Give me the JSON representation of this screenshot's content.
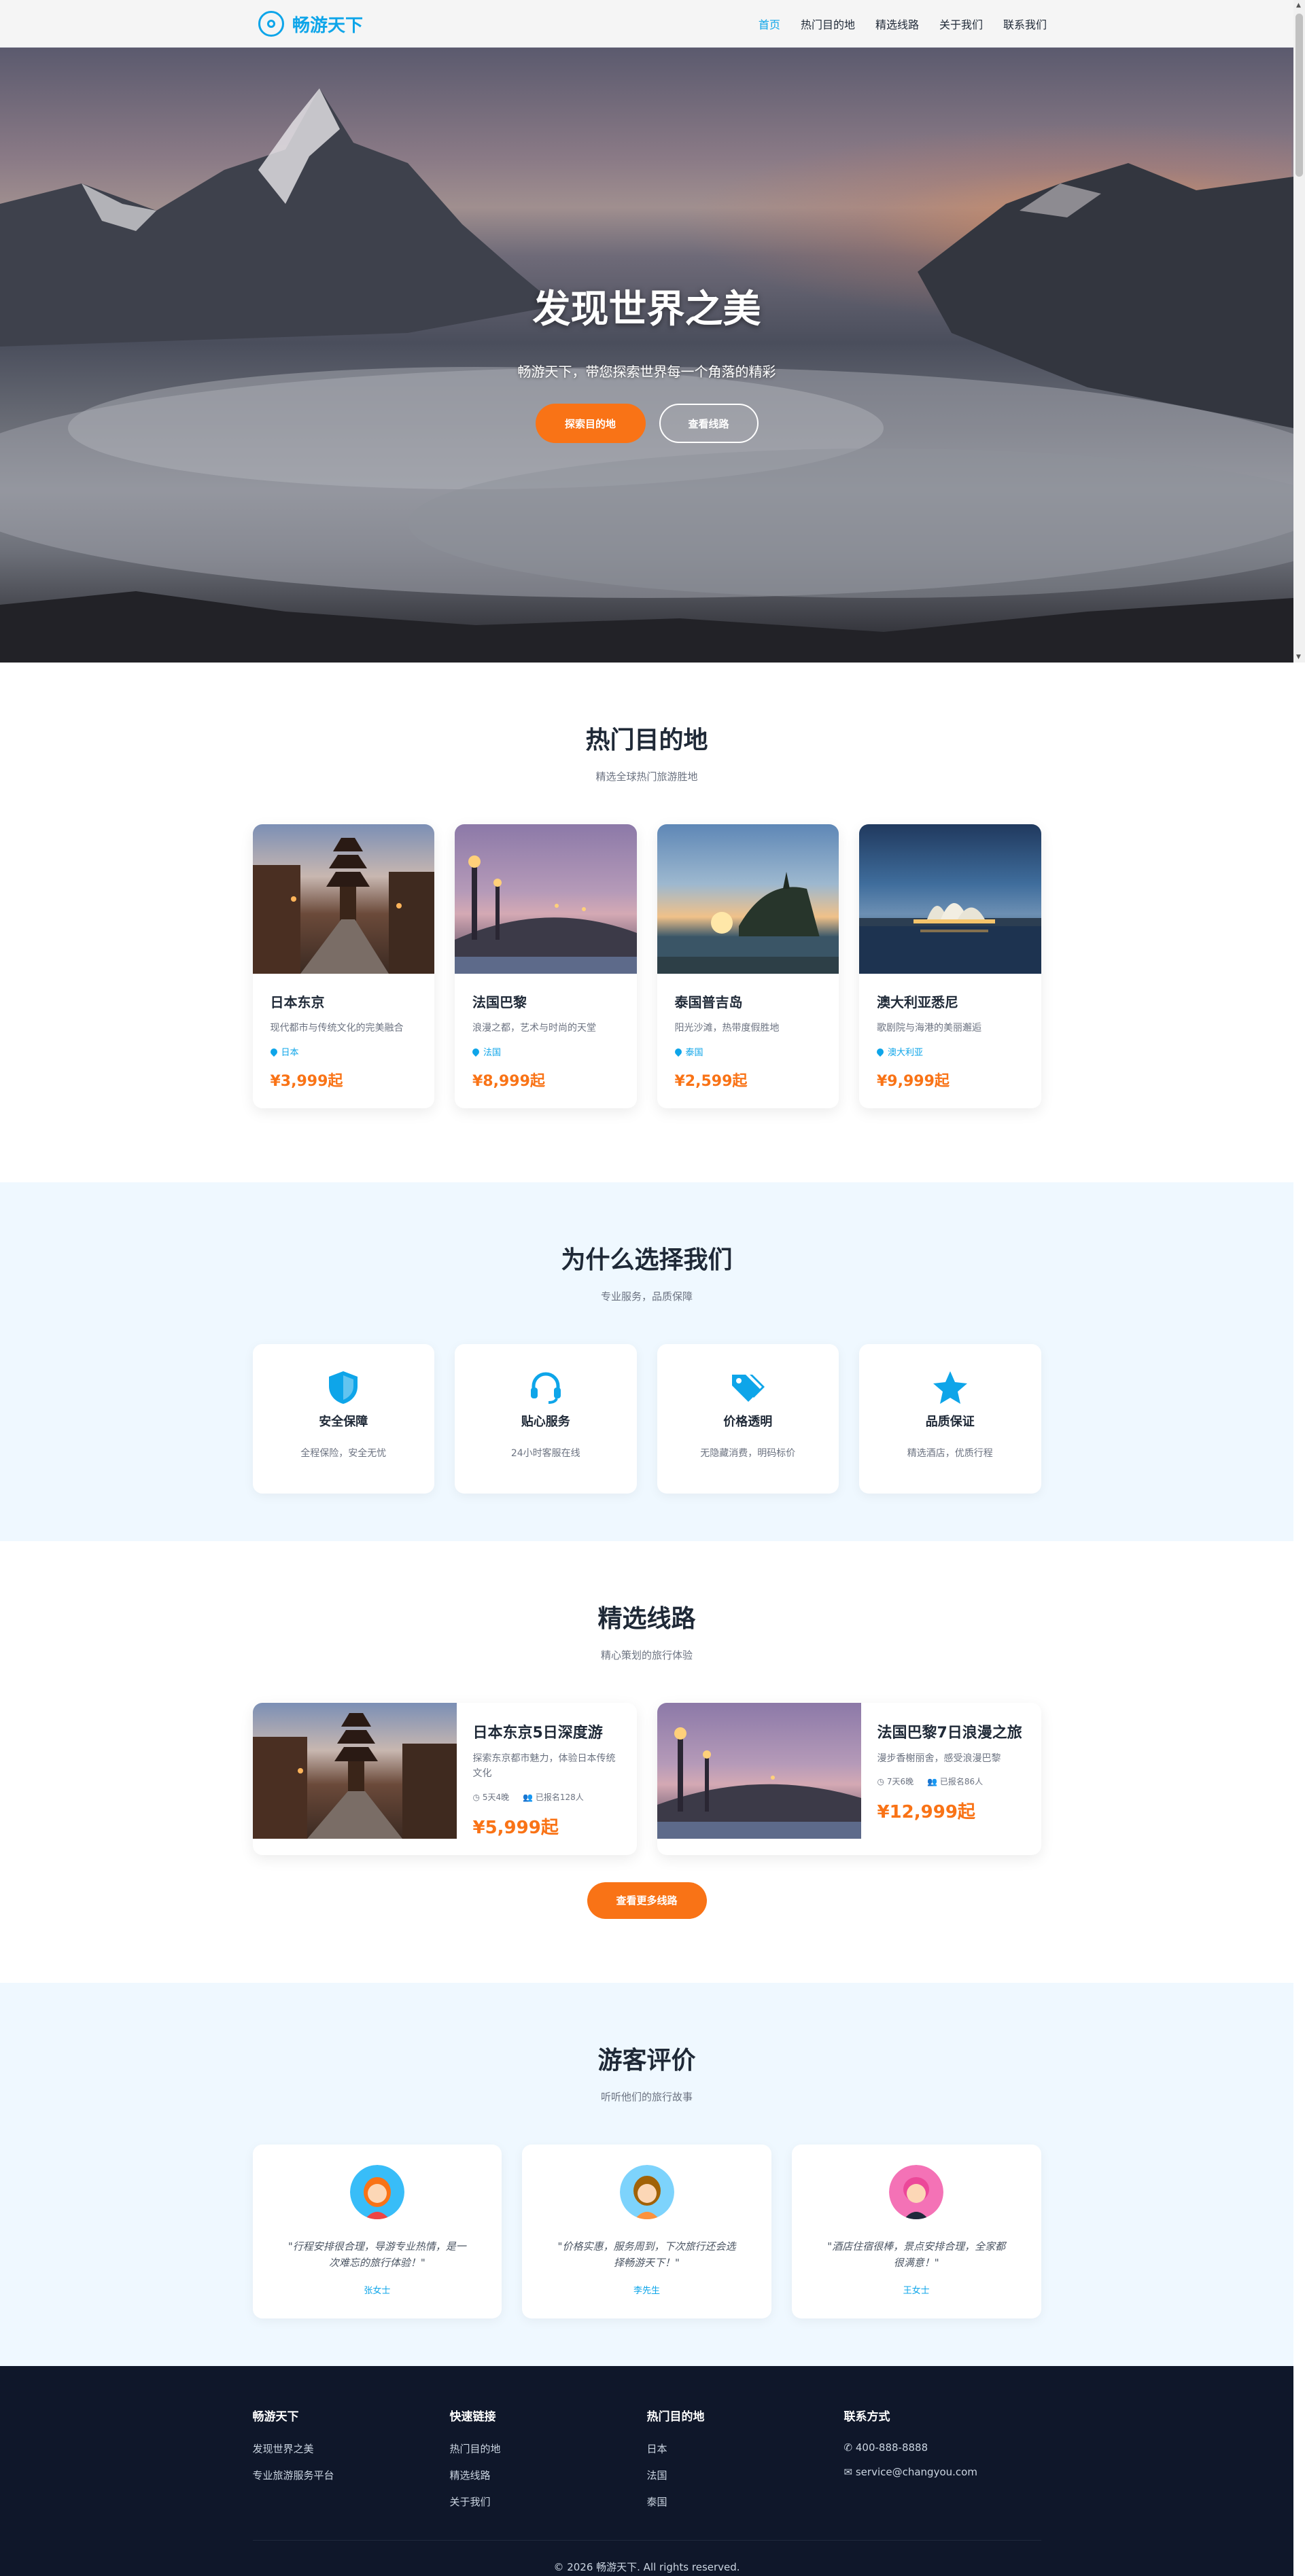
{
  "brand": {
    "name": "畅游天下"
  },
  "nav": {
    "items": [
      {
        "label": "首页",
        "active": true
      },
      {
        "label": "热门目的地"
      },
      {
        "label": "精选线路"
      },
      {
        "label": "关于我们"
      },
      {
        "label": "联系我们"
      }
    ]
  },
  "hero": {
    "title": "发现世界之美",
    "subtitle": "畅游天下，带您探索世界每一个角落的精彩",
    "primary_button": "探索目的地",
    "secondary_button": "查看线路"
  },
  "destinations": {
    "title": "热门目的地",
    "subtitle": "精选全球热门旅游胜地",
    "items": [
      {
        "name": "日本东京",
        "desc": "现代都市与传统文化的完美融合",
        "location": "日本",
        "price": "¥3,999起",
        "scene": "pagoda-street"
      },
      {
        "name": "法国巴黎",
        "desc": "浪漫之都，艺术与时尚的天堂",
        "location": "法国",
        "price": "¥8,999起",
        "scene": "bridge-lamps"
      },
      {
        "name": "泰国普吉岛",
        "desc": "阳光沙滩，热带度假胜地",
        "location": "泰国",
        "price": "¥2,599起",
        "scene": "temple-sunset"
      },
      {
        "name": "澳大利亚悉尼",
        "desc": "歌剧院与海港的美丽邂逅",
        "location": "澳大利亚",
        "price": "¥9,999起",
        "scene": "opera-house"
      }
    ]
  },
  "why": {
    "title": "为什么选择我们",
    "subtitle": "专业服务，品质保障",
    "items": [
      {
        "name": "安全保障",
        "desc": "全程保险，安全无忧",
        "icon": "shield-icon"
      },
      {
        "name": "贴心服务",
        "desc": "24小时客服在线",
        "icon": "headset-icon"
      },
      {
        "name": "价格透明",
        "desc": "无隐藏消费，明码标价",
        "icon": "tag-icon"
      },
      {
        "name": "品质保证",
        "desc": "精选酒店，优质行程",
        "icon": "star-icon"
      }
    ]
  },
  "routes": {
    "title": "精选线路",
    "subtitle": "精心策划的旅行体验",
    "items": [
      {
        "name": "日本东京5日深度游",
        "desc": "探索东京都市魅力，体验日本传统文化",
        "duration": "5天4晚",
        "signed": "已报名128人",
        "price": "¥5,999起"
      },
      {
        "name": "法国巴黎7日浪漫之旅",
        "desc": "漫步香榭丽舍，感受浪漫巴黎",
        "duration": "7天6晚",
        "signed": "已报名86人",
        "price": "¥12,999起"
      }
    ],
    "more_button": "查看更多线路"
  },
  "reviews": {
    "title": "游客评价",
    "subtitle": "听听他们的旅行故事",
    "items": [
      {
        "text": "\"行程安排很合理，导游专业热情，是一次难忘的旅行体验！\"",
        "name": "张女士",
        "avatar_color": "#38bdf8"
      },
      {
        "text": "\"价格实惠，服务周到，下次旅行还会选择畅游天下！\"",
        "name": "李先生",
        "avatar_color": "#7dd3fc"
      },
      {
        "text": "\"酒店住宿很棒，景点安排合理，全家都很满意！\"",
        "name": "王女士",
        "avatar_color": "#f472b6"
      }
    ]
  },
  "footer": {
    "col1": {
      "title": "畅游天下",
      "lines": [
        "发现世界之美",
        "专业旅游服务平台"
      ]
    },
    "col2": {
      "title": "快速链接",
      "links": [
        "热门目的地",
        "精选线路",
        "关于我们"
      ]
    },
    "col3": {
      "title": "热门目的地",
      "links": [
        "日本",
        "法国",
        "泰国"
      ]
    },
    "col4": {
      "title": "联系方式",
      "phone": "400-888-8888",
      "email": "service@changyou.com"
    },
    "copyright": "© 2026 畅游天下. All rights reserved."
  },
  "colors": {
    "accent": "#0ea5e9",
    "cta": "#f97316",
    "footer_bg": "#0f172a",
    "section_bg": "#eff8ff"
  }
}
